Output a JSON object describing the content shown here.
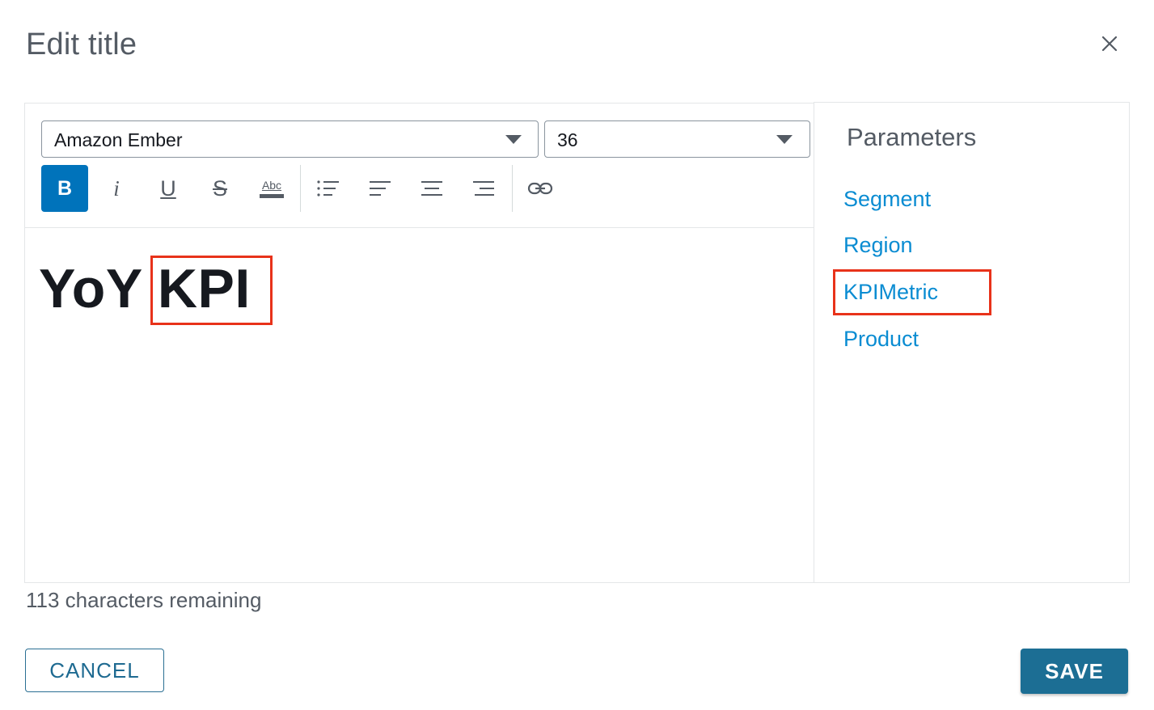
{
  "dialog": {
    "title": "Edit title",
    "close_icon": "close-icon"
  },
  "toolbar": {
    "font_family": "Amazon Ember",
    "font_size": "36",
    "bold_label": "B",
    "italic_label": "i",
    "underline_label": "U",
    "strikethrough_label": "S",
    "text_color_label": "Abc",
    "active_tool": "bold",
    "icons": [
      "bold-icon",
      "italic-icon",
      "underline-icon",
      "strikethrough-icon",
      "text-color-icon",
      "bulleted-list-icon",
      "align-left-icon",
      "align-center-icon",
      "align-right-icon",
      "link-icon"
    ]
  },
  "editor": {
    "text_part1": "YoY ",
    "text_part2": "KPI"
  },
  "parameters": {
    "title": "Parameters",
    "items": [
      "Segment",
      "Region",
      "KPIMetric",
      "Product"
    ],
    "highlighted_item": "KPIMetric"
  },
  "status": {
    "characters_remaining": "113 characters remaining"
  },
  "actions": {
    "cancel_label": "CANCEL",
    "save_label": "SAVE"
  },
  "colors": {
    "primary": "#0073bb",
    "link": "#0a8cd2",
    "save_button": "#1c6e94",
    "highlight_box": "#e8321a"
  }
}
